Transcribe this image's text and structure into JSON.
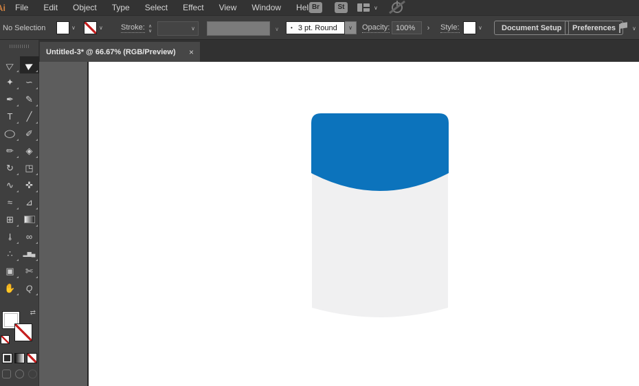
{
  "menubar": {
    "logo": "Ai",
    "items": [
      "File",
      "Edit",
      "Object",
      "Type",
      "Select",
      "Effect",
      "View",
      "Window",
      "Help"
    ],
    "bridge_label": "Br",
    "stock_label": "St"
  },
  "controlbar": {
    "selection_status": "No Selection",
    "stroke_label": "Stroke:",
    "brush_dot": "•",
    "brush_value": "3 pt. Round",
    "opacity_label": "Opacity:",
    "opacity_value": "100%",
    "expand_chevron": "›",
    "style_label": "Style:",
    "document_setup_label": "Document Setup",
    "preferences_label": "Preferences"
  },
  "tabbar": {
    "active_tab_title": "Untitled-3* @ 66.67% (RGB/Preview)",
    "close_glyph": "×"
  },
  "icons": {
    "chevron_down": "∨",
    "stepper_up": "∧",
    "stepper_down": "∨",
    "swap_arrows": "⇄"
  },
  "toolbar": {
    "tools": [
      {
        "name": "direct-selection-tool",
        "glyph": "▷"
      },
      {
        "name": "selection-tool",
        "glyph": "▶",
        "active": true
      },
      {
        "name": "magic-wand-tool",
        "glyph": "✦"
      },
      {
        "name": "lasso-tool",
        "glyph": "∽"
      },
      {
        "name": "pen-tool",
        "glyph": "✒"
      },
      {
        "name": "curvature-tool",
        "glyph": "✎"
      },
      {
        "name": "type-tool",
        "glyph": "T"
      },
      {
        "name": "line-segment-tool",
        "glyph": "╱"
      },
      {
        "name": "ellipse-tool",
        "glyph": "◯"
      },
      {
        "name": "paintbrush-tool",
        "glyph": "✐"
      },
      {
        "name": "pencil-tool",
        "glyph": "✏"
      },
      {
        "name": "eraser-tool",
        "glyph": "◈"
      },
      {
        "name": "rotate-tool",
        "glyph": "↻"
      },
      {
        "name": "scale-tool",
        "glyph": "◳"
      },
      {
        "name": "width-tool",
        "glyph": "∿"
      },
      {
        "name": "puppet-warp-tool",
        "glyph": "✜"
      },
      {
        "name": "shaper-tool",
        "glyph": "≈"
      },
      {
        "name": "perspective-grid-tool",
        "glyph": "⊿"
      },
      {
        "name": "mesh-tool",
        "glyph": "⊞"
      },
      {
        "name": "gradient-tool",
        "glyph": ""
      },
      {
        "name": "eyedropper-tool",
        "glyph": "⊸"
      },
      {
        "name": "blend-tool",
        "glyph": "∞"
      },
      {
        "name": "symbol-sprayer-tool",
        "glyph": "∴"
      },
      {
        "name": "column-graph-tool",
        "glyph": "▂▆▄"
      },
      {
        "name": "artboard-tool",
        "glyph": "▣"
      },
      {
        "name": "slice-tool",
        "glyph": "✄"
      },
      {
        "name": "hand-tool",
        "glyph": "✋"
      },
      {
        "name": "zoom-tool",
        "glyph": "Q"
      }
    ]
  },
  "canvas": {
    "cap_color": "#0c73bc",
    "body_color": "#f0f0f1"
  }
}
